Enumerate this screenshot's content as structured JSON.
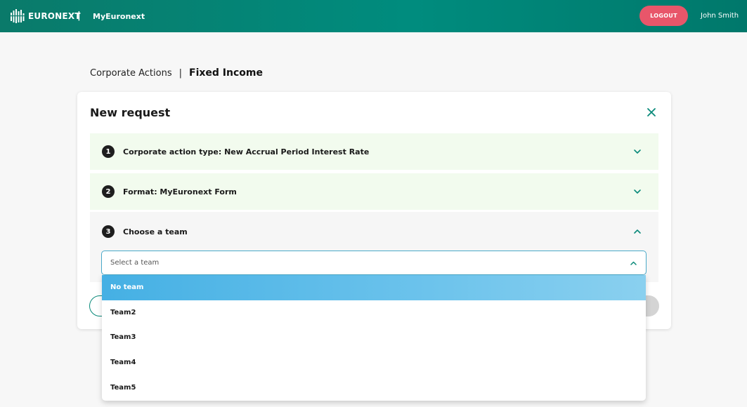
{
  "header": {
    "brand": "EURONEXT",
    "separator": "|",
    "app_name": "MyEuronext",
    "logout_label": "LOGOUT",
    "user_name": "John Smith"
  },
  "breadcrumb": {
    "parent": "Corporate Actions",
    "separator": "|",
    "current": "Fixed Income"
  },
  "card": {
    "title": "New request",
    "steps": [
      {
        "number": "1",
        "label": "Corporate action type: New Accrual Period Interest Rate",
        "state": "collapsed"
      },
      {
        "number": "2",
        "label": "Format: MyEuronext Form",
        "state": "collapsed"
      },
      {
        "number": "3",
        "label": "Choose a team",
        "state": "expanded"
      }
    ]
  },
  "team_select": {
    "placeholder": "Select a team",
    "options": [
      "No team",
      "Team2",
      "Team3",
      "Team4",
      "Team5"
    ],
    "highlighted": "No team"
  },
  "colors": {
    "header_bg": "#008c7e",
    "logout_bg": "#e8566a",
    "accent": "#0a8a7a",
    "step_done_bg": "#f2fbee",
    "highlight_option": "#45b0e4"
  }
}
